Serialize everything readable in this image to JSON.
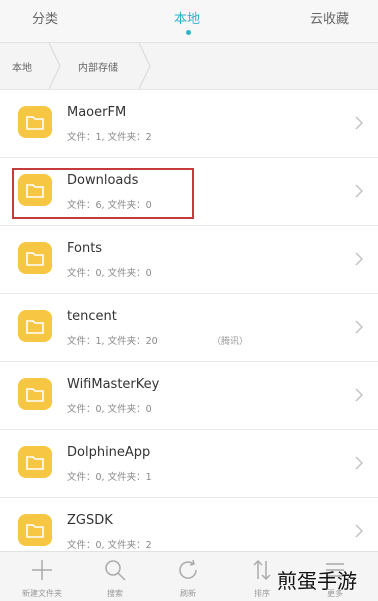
{
  "tabs": {
    "items": [
      {
        "label": "分类"
      },
      {
        "label": "本地"
      },
      {
        "label": "云收藏"
      }
    ],
    "active_color": "#2fb3c6"
  },
  "breadcrumb": {
    "items": [
      {
        "label": "本地"
      },
      {
        "label": "内部存储"
      }
    ]
  },
  "files": [
    {
      "name": "MaoerFM",
      "meta": "文件：1, 文件夹：2",
      "note": ""
    },
    {
      "name": "Downloads",
      "meta": "文件：6, 文件夹：0",
      "note": ""
    },
    {
      "name": "Fonts",
      "meta": "文件：0, 文件夹：0",
      "note": ""
    },
    {
      "name": "tencent",
      "meta": "文件：1, 文件夹：20",
      "note": "（腾讯）"
    },
    {
      "name": "WifiMasterKey",
      "meta": "文件：0, 文件夹：0",
      "note": ""
    },
    {
      "name": "DolphineApp",
      "meta": "文件：0, 文件夹：1",
      "note": ""
    },
    {
      "name": "ZGSDK",
      "meta": "文件：0, 文件夹：2",
      "note": ""
    }
  ],
  "toolbar": {
    "new_folder": "新建文件夹",
    "search": "搜索",
    "refresh": "刷新",
    "sort": "排序",
    "more": "更多"
  },
  "watermark": "煎蛋手游",
  "folder_color": "#f7c744",
  "highlight_color": "#c53a3a"
}
